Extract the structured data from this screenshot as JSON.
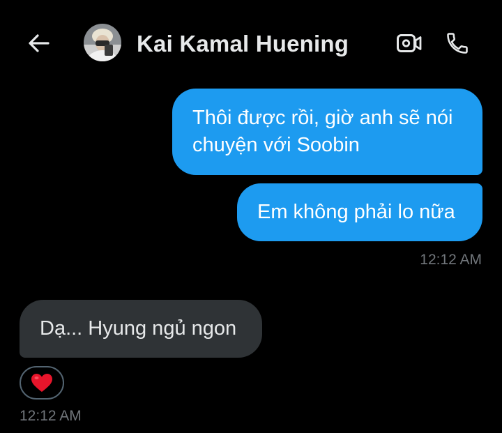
{
  "header": {
    "contact_name": "Kai Kamal Huening"
  },
  "messages": [
    {
      "direction": "outgoing",
      "text": "Thôi được rồi, giờ anh sẽ nói chuyện với Soobin"
    },
    {
      "direction": "outgoing",
      "text": "Em không phải lo nữa"
    },
    {
      "direction": "incoming",
      "text": "Dạ... Hyung ngủ ngon"
    }
  ],
  "timestamps": {
    "outgoing": "12:12 AM",
    "incoming": "12:12 AM"
  },
  "reaction": {
    "emoji": "❤️"
  },
  "colors": {
    "background": "#000000",
    "outgoing_bubble": "#1d9bf0",
    "incoming_bubble": "#2f3336",
    "timestamp": "#71767b",
    "heart": "#f4212e"
  },
  "icons": {
    "back": "back-arrow-icon",
    "video": "video-call-icon",
    "call": "phone-icon"
  }
}
